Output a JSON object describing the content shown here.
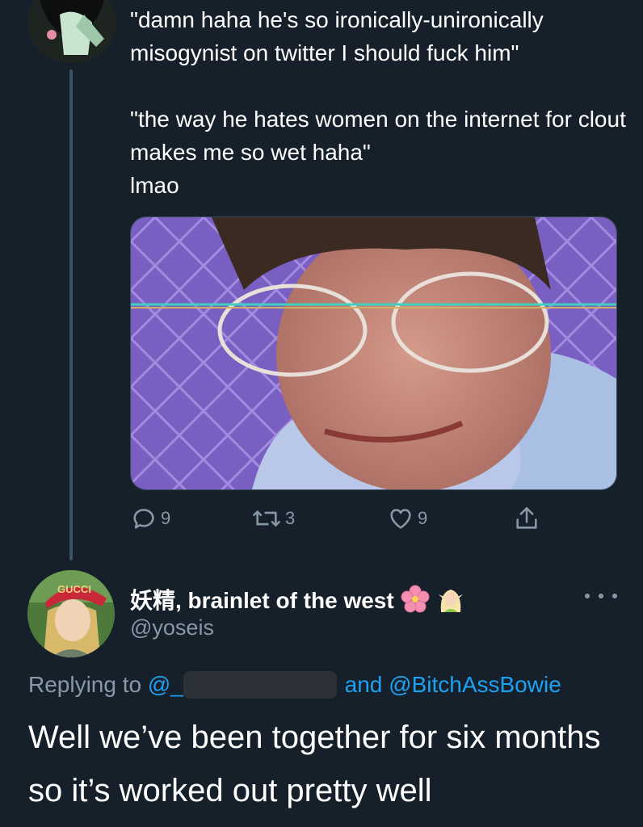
{
  "tweet": {
    "lines": [
      "\"damn haha he's so ironically-unironically misogynist on twitter I should fuck him\"",
      "\"the way he hates women on the internet for clout makes me so wet haha\"",
      "lmao"
    ],
    "actions": {
      "reply_count": "9",
      "retweet_count": "3",
      "like_count": "9"
    }
  },
  "reply": {
    "display_name": "妖精, brainlet of the west",
    "emoji": [
      "cherry-blossom",
      "elf-woman"
    ],
    "handle": "@yoseis",
    "replying_prefix": "Replying to",
    "replying_to_first": "@_",
    "replying_and": "and",
    "replying_to_second": "@BitchAssBowie",
    "text": "Well we’ve been together for six months so it’s worked out pretty well",
    "avatar_hat_text": "GUCCI"
  },
  "colors": {
    "background": "#15202b",
    "secondary_text": "#8899a6",
    "link": "#1da1f2"
  }
}
